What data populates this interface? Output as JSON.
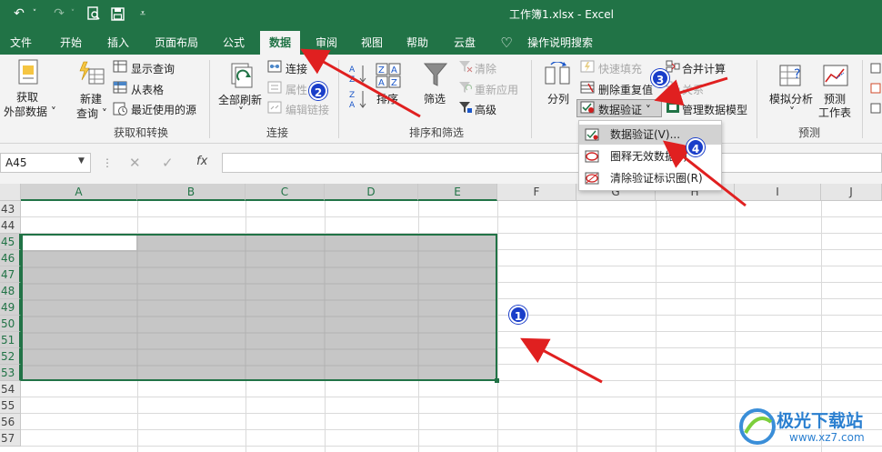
{
  "title_bar": {
    "doc_title": "工作簿1.xlsx  -  Excel",
    "qat": [
      "undo-icon",
      "redo-icon",
      "print-preview-icon",
      "save-icon",
      "customize-icon"
    ]
  },
  "tabs": [
    "文件",
    "开始",
    "插入",
    "页面布局",
    "公式",
    "数据",
    "审阅",
    "视图",
    "帮助",
    "云盘",
    "操作说明搜索"
  ],
  "active_tab": "数据",
  "ribbon": {
    "get_data": {
      "line1": "获取",
      "line2": "外部数据 ˅"
    },
    "new_query": {
      "line1": "新建",
      "line2": "查询 ˅"
    },
    "show_query": "显示查询",
    "from_table": "从表格",
    "recent_sources": "最近使用的源",
    "group1_label": "获取和转换",
    "refresh_all": {
      "line1": "全部刷新",
      "line2": "˅"
    },
    "connections": "连接",
    "properties": "属性",
    "edit_links": "编辑链接",
    "group2_label": "连接",
    "sort_az": "A→Z",
    "sort_za": "Z→A",
    "sort": "排序",
    "filter": "筛选",
    "clear": "清除",
    "reapply": "重新应用",
    "advanced": "高级",
    "group3_label": "排序和筛选",
    "text_to_columns": "分列",
    "flash_fill": "快速填充",
    "remove_duplicates": "删除重复值",
    "data_validation": "数据验证 ˅",
    "consolidate": "合并计算",
    "relationships": "关系",
    "manage_data_model": "管理数据模型",
    "what_if": {
      "line1": "模拟分析",
      "line2": "˅"
    },
    "forecast_sheet": {
      "line1": "预测",
      "line2": "工作表"
    },
    "group5_label": "预测"
  },
  "formula_bar": {
    "name_box": "A45",
    "fx": "fx",
    "value": ""
  },
  "columns": [
    "A",
    "B",
    "C",
    "D",
    "E",
    "F",
    "G",
    "H",
    "I",
    "J"
  ],
  "rows": [
    "43",
    "44",
    "45",
    "46",
    "47",
    "48",
    "49",
    "50",
    "51",
    "52",
    "53",
    "54",
    "55",
    "56",
    "57"
  ],
  "dropdown_menu": {
    "items": [
      "数据验证(V)...",
      "圈释无效数据(I)",
      "清除验证标识圈(R)"
    ]
  },
  "badges": [
    "1",
    "2",
    "3",
    "4"
  ],
  "watermark": {
    "name": "极光下载站",
    "url": "www.xz7.com"
  },
  "colors": {
    "excel_green": "#217346",
    "selection": "#c6c6c6",
    "badge": "#1a3ec9",
    "arrow": "#e02020"
  }
}
